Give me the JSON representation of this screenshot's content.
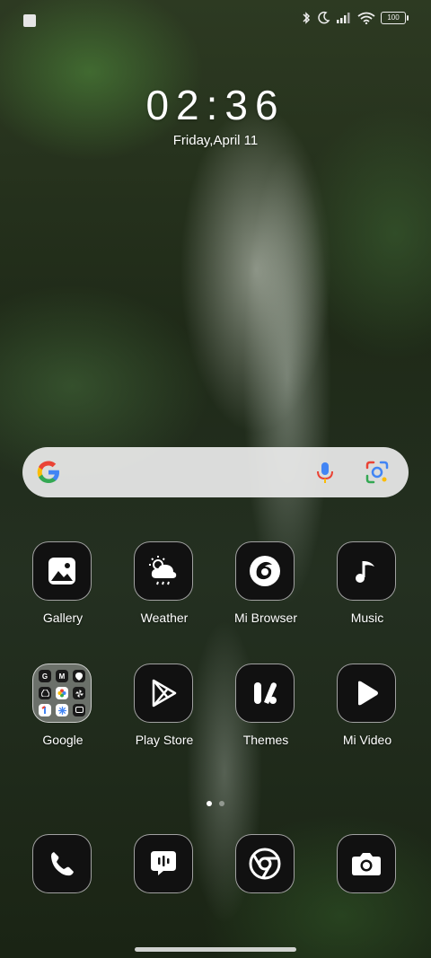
{
  "status_bar": {
    "battery": "100"
  },
  "clock": {
    "time": "02:36",
    "date": "Friday,April 11"
  },
  "apps": [
    {
      "label": "Gallery",
      "icon": "gallery-icon"
    },
    {
      "label": "Weather",
      "icon": "weather-icon"
    },
    {
      "label": "Mi Browser",
      "icon": "mi-browser-icon"
    },
    {
      "label": "Music",
      "icon": "music-icon"
    },
    {
      "label": "Google",
      "icon": "google-folder-icon"
    },
    {
      "label": "Play Store",
      "icon": "play-store-icon"
    },
    {
      "label": "Themes",
      "icon": "themes-icon"
    },
    {
      "label": "Mi Video",
      "icon": "mi-video-icon"
    }
  ],
  "folder_minis": [
    "G",
    "M",
    "",
    "",
    "",
    "",
    "",
    "",
    ""
  ],
  "dock": [
    {
      "icon": "phone-icon"
    },
    {
      "icon": "messages-icon"
    },
    {
      "icon": "chrome-icon"
    },
    {
      "icon": "camera-icon"
    }
  ],
  "colors": {
    "google_blue": "#4285F4",
    "google_red": "#EA4335",
    "google_yellow": "#FBBC05",
    "google_green": "#34A853"
  }
}
